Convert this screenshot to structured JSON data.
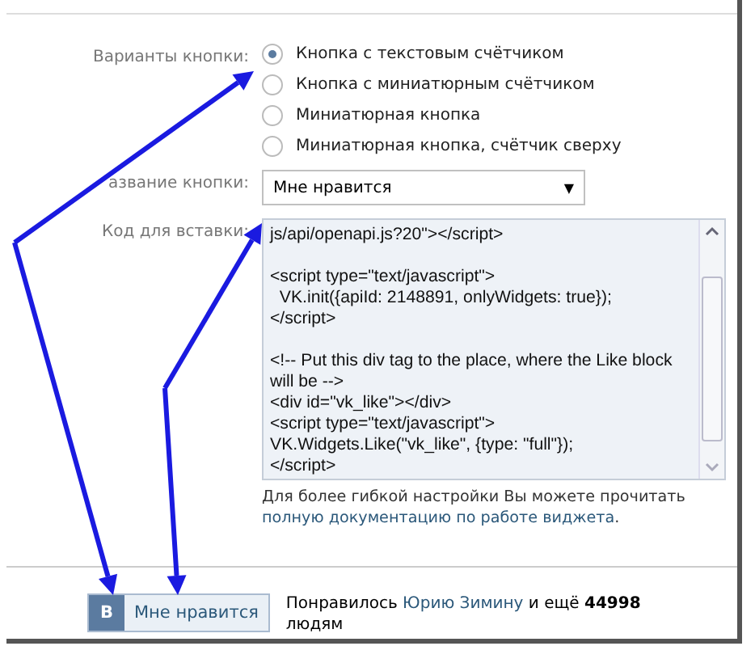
{
  "button_variants": {
    "label": "Варианты кнопки:",
    "options": [
      {
        "label": "Кнопка с текстовым счётчиком",
        "selected": true
      },
      {
        "label": "Кнопка с миниатюрным счётчиком",
        "selected": false
      },
      {
        "label": "Миниатюрная кнопка",
        "selected": false
      },
      {
        "label": "Миниатюрная кнопка, счётчик сверху",
        "selected": false
      }
    ]
  },
  "button_name": {
    "label": "азвание кнопки:",
    "value": "Мне нравится",
    "caret": "▼"
  },
  "embed_code": {
    "label": "Код для вставки:",
    "blocks": [
      [
        "js/api/openapi.js?20\"></script>"
      ],
      [
        "<script type=\"text/javascript\">",
        "  VK.init({apiId: 2148891, onlyWidgets: true});",
        "</script>"
      ],
      [
        "<!-- Put this div tag to the place, where the Like block will be -->",
        "<div id=\"vk_like\"></div>",
        "<script type=\"text/javascript\">",
        "VK.Widgets.Like(\"vk_like\", {type: \"full\"});",
        "</script>"
      ]
    ]
  },
  "help": {
    "text": "Для более гибкой настройки Вы можете прочитать",
    "link": "полную документацию по работе виджета",
    "end": "."
  },
  "preview": {
    "logo": "В",
    "button": "Мне нравится",
    "prefix": "Понравилось",
    "name": "Юрию Зимину",
    "middle": "и ещё",
    "count": "44998",
    "suffix": "людям"
  }
}
